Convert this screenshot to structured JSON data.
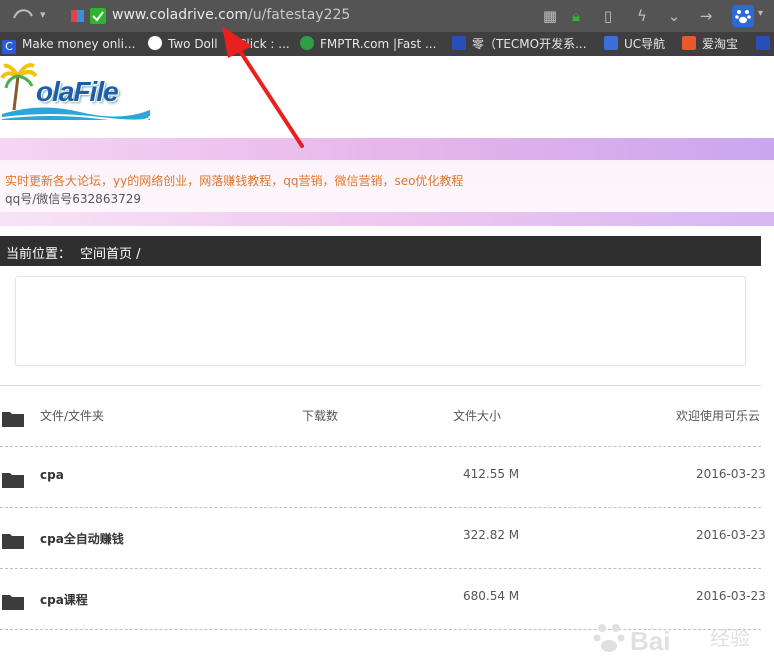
{
  "browser": {
    "url_host": "www.coladrive.com",
    "url_path": "/u/fatestay225",
    "bookmarks": [
      {
        "label": "Make money onli...",
        "color": "#2a5bd7"
      },
      {
        "label": "Two Doll",
        "color": "#e74c8b"
      },
      {
        "label": "Click : ...",
        "color": "#3f3f3f"
      },
      {
        "label": "FMPTR.com |Fast ...",
        "color": "#2f9e44"
      },
      {
        "label": "零（TECMO开发系...",
        "color": "#2a4fb8"
      },
      {
        "label": "UC导航",
        "color": "#3b6fd8"
      },
      {
        "label": "爱淘宝",
        "color": "#e8592b"
      }
    ]
  },
  "site": {
    "logo_text": "olaFile"
  },
  "banner": {
    "line1": "实时更新各大论坛，yy的网络创业，网落赚钱教程，qq营销，微信营销，seo优化教程",
    "line2": "qq号/微信号632863729"
  },
  "breadcrumb": {
    "label": "当前位置：",
    "path": "空间首页 /"
  },
  "table": {
    "headers": {
      "name": "文件/文件夹",
      "downloads": "下载数",
      "size": "文件大小",
      "date": "欢迎使用可乐云"
    },
    "rows": [
      {
        "name": "cpa",
        "size": "412.55 M",
        "date": "2016-03-23"
      },
      {
        "name": "cpa全自动赚钱",
        "size": "322.82 M",
        "date": "2016-03-23"
      },
      {
        "name": "cpa课程",
        "size": "680.54 M",
        "date": "2016-03-23"
      }
    ]
  },
  "watermark": {
    "text": "Bai",
    "text2": "经验"
  },
  "colors": {
    "breadcrumb_bg": "#2f2f2f",
    "banner_text": "#e0762a",
    "arrow": "#e8211f"
  }
}
